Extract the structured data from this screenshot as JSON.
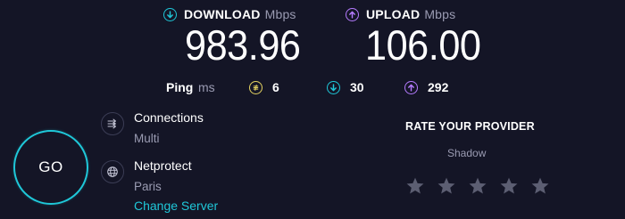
{
  "download": {
    "label": "DOWNLOAD",
    "unit": "Mbps",
    "value": "983.96",
    "color": "#1fc7d8",
    "icon": "arrow-down-circle-icon"
  },
  "upload": {
    "label": "UPLOAD",
    "unit": "Mbps",
    "value": "106.00",
    "color": "#b57bff",
    "icon": "arrow-up-circle-icon"
  },
  "ping": {
    "label": "Ping",
    "unit": "ms",
    "idle": {
      "value": "6",
      "color": "#e5d361",
      "icon": "idle-latency-icon"
    },
    "download": {
      "value": "30",
      "color": "#1fc7d8",
      "icon": "download-latency-icon"
    },
    "upload": {
      "value": "292",
      "color": "#b57bff",
      "icon": "upload-latency-icon"
    }
  },
  "go_button": {
    "label": "GO",
    "color": "#1fc7d8"
  },
  "connections": {
    "title": "Connections",
    "mode": "Multi",
    "icon": "connections-icon"
  },
  "server": {
    "name": "Netprotect",
    "location": "Paris",
    "change_label": "Change Server",
    "icon": "globe-icon"
  },
  "rating": {
    "title": "RATE YOUR PROVIDER",
    "provider": "Shadow",
    "stars_total": 5,
    "stars_selected": 0
  }
}
